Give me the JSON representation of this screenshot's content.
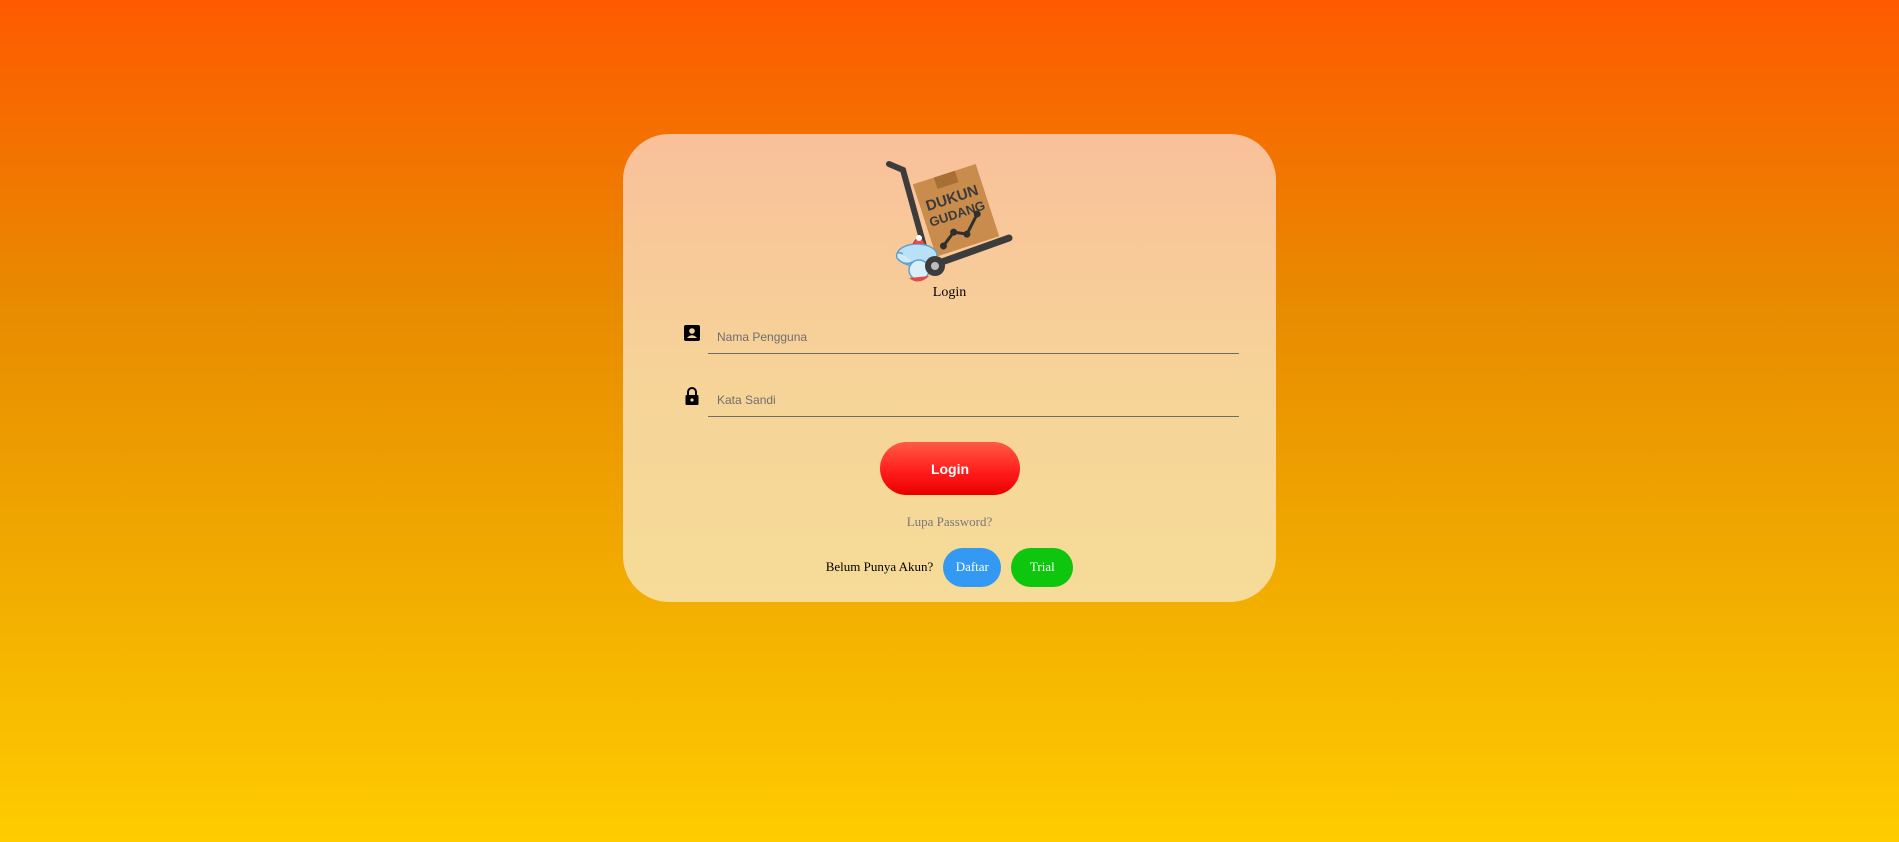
{
  "logo": {
    "text_line1": "DUKUN",
    "text_line2": "GUDANG"
  },
  "form": {
    "title": "Login",
    "username_placeholder": "Nama Pengguna",
    "password_placeholder": "Kata Sandi",
    "login_button": "Login",
    "forgot_password": "Lupa Password?",
    "no_account": "Belum Punya Akun?",
    "register_button": "Daftar",
    "trial_button": "Trial"
  },
  "colors": {
    "background_top": "#ff5a00",
    "background_bottom": "#ffcc00",
    "login_button": "#ff1a1a",
    "register_button": "#3399f3",
    "trial_button": "#0dc60d"
  },
  "icons": {
    "username": "contact-card-icon",
    "password": "lock-icon"
  }
}
